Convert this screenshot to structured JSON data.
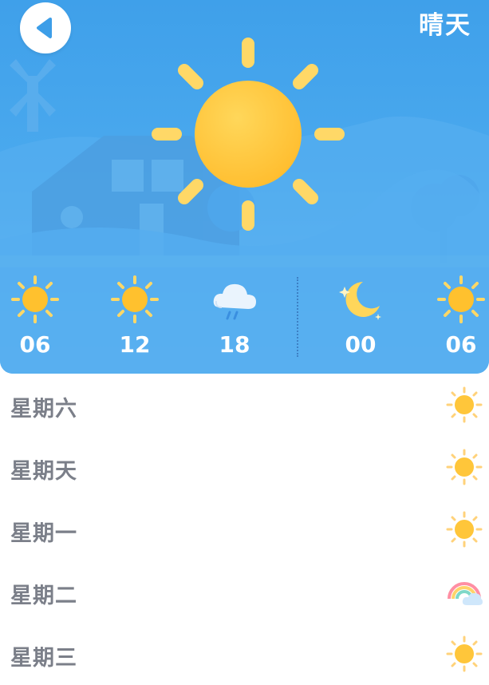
{
  "header": {
    "back_icon": "chevron-left-icon",
    "condition": "晴天",
    "main_icon": "sun-icon"
  },
  "hourly": [
    {
      "time": "06",
      "icon": "sun-icon"
    },
    {
      "time": "12",
      "icon": "sun-icon"
    },
    {
      "time": "18",
      "icon": "rain-cloud-icon"
    },
    {
      "time": "00",
      "icon": "moon-icon"
    },
    {
      "time": "06",
      "icon": "sun-icon"
    }
  ],
  "forecast": [
    {
      "day": "星期六",
      "icon": "sun-icon"
    },
    {
      "day": "星期天",
      "icon": "sun-icon"
    },
    {
      "day": "星期一",
      "icon": "sun-icon"
    },
    {
      "day": "星期二",
      "icon": "rainbow-icon"
    },
    {
      "day": "星期三",
      "icon": "sun-icon"
    }
  ],
  "colors": {
    "sky_top": "#3fa0ea",
    "sky_bottom": "#8dcbf5",
    "sun": "#ffc93c",
    "sun_ray": "#ffd867",
    "day_text": "#7b7f89"
  }
}
